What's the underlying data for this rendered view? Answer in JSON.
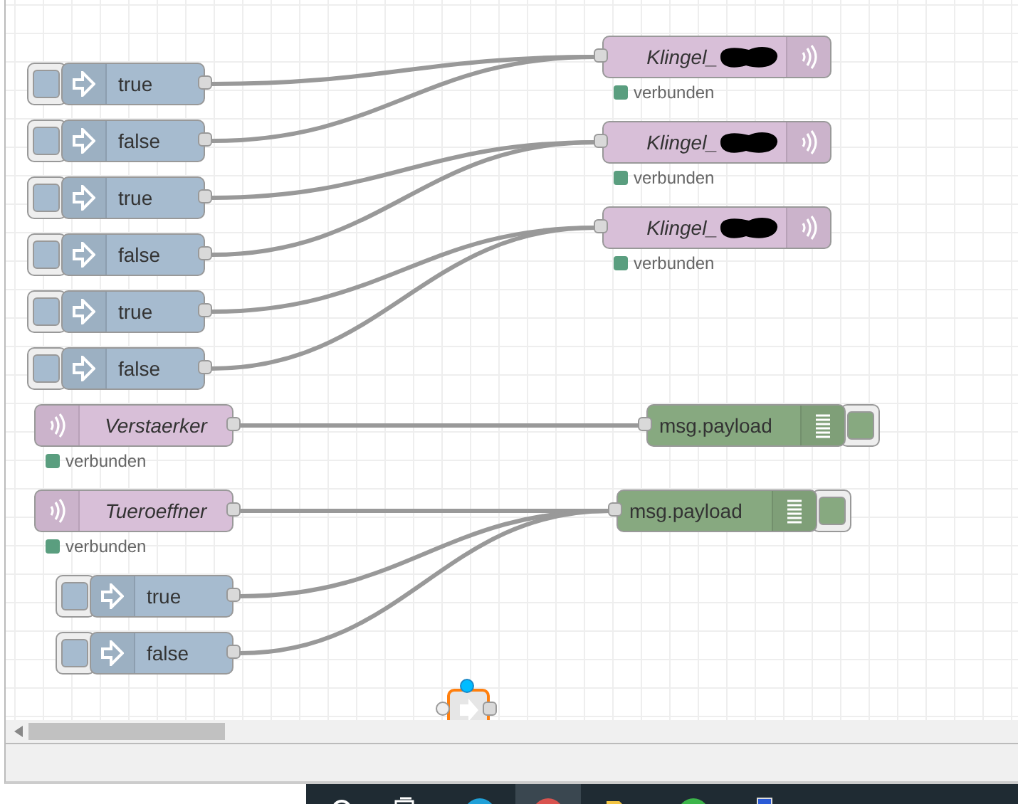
{
  "nodes": [
    {
      "kind": "mqtt_out",
      "label": "Klingel_",
      "redacted": true,
      "status": {
        "text": "verbunden",
        "color": "#5a9e7f"
      }
    },
    {
      "kind": "mqtt_out",
      "label": "Klingel_",
      "redacted": true,
      "status": {
        "text": "verbunden",
        "color": "#5a9e7f"
      }
    },
    {
      "kind": "mqtt_out",
      "label": "Klingel_",
      "redacted": true,
      "status": {
        "text": "verbunden",
        "color": "#5a9e7f"
      }
    },
    {
      "kind": "inject",
      "label": "true"
    },
    {
      "kind": "inject",
      "label": "false"
    },
    {
      "kind": "inject",
      "label": "true"
    },
    {
      "kind": "inject",
      "label": "false"
    },
    {
      "kind": "inject",
      "label": "true"
    },
    {
      "kind": "inject",
      "label": "false"
    },
    {
      "kind": "mqtt_in",
      "label": "Verstaerker",
      "status": {
        "text": "verbunden",
        "color": "#5a9e7f"
      }
    },
    {
      "kind": "debug",
      "label": "msg.payload",
      "active": true
    },
    {
      "kind": "mqtt_in",
      "label": "Tueroeffner",
      "status": {
        "text": "verbunden",
        "color": "#5a9e7f"
      }
    },
    {
      "kind": "debug",
      "label": "msg.payload",
      "active": true
    },
    {
      "kind": "inject",
      "label": "true"
    },
    {
      "kind": "inject",
      "label": "false"
    },
    {
      "kind": "partial",
      "selected": true,
      "changed": true
    }
  ]
}
